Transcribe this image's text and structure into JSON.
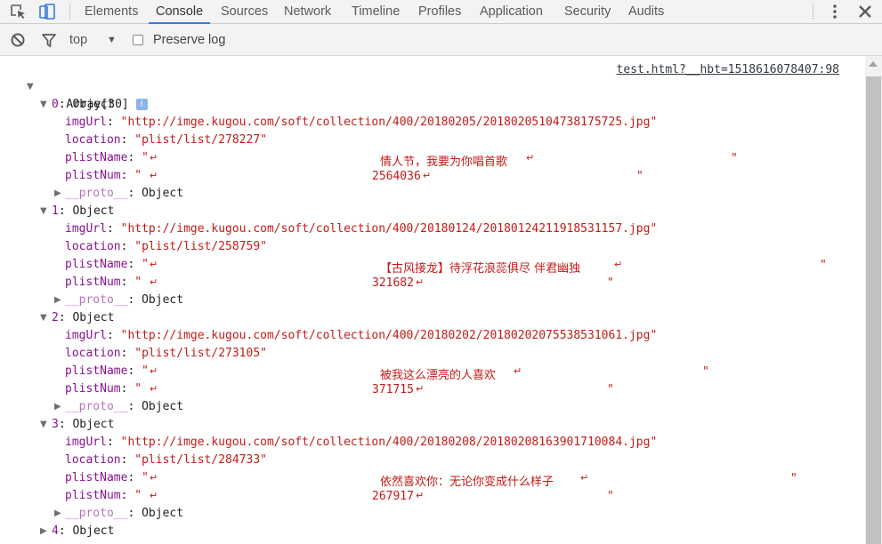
{
  "tabs": [
    "Elements",
    "Console",
    "Sources",
    "Network",
    "Timeline",
    "Profiles",
    "Application",
    "Security",
    "Audits"
  ],
  "active_tab": "Console",
  "toolbar": {
    "context": "top",
    "preserve_log": "Preserve log"
  },
  "source_link": "test.html?__hbt=1518616078407:98",
  "array_label": "Array[30]",
  "info_badge": "i",
  "labels": {
    "object": "Object",
    "proto": "__proto__",
    "imgUrl": "imgUrl",
    "location": "location",
    "plistName": "plistName",
    "plistNum": "plistNum",
    "return_mark": "↵",
    "quote": "\""
  },
  "items": [
    {
      "index": "0",
      "imgUrl": "\"http://imge.kugou.com/soft/collection/400/20180205/20180205104738175725.jpg\"",
      "location": "\"plist/list/278227\"",
      "plistName": "情人节，我要为你唱首歌",
      "plistNum": "2564036"
    },
    {
      "index": "1",
      "imgUrl": "\"http://imge.kugou.com/soft/collection/400/20180124/20180124211918531157.jpg\"",
      "location": "\"plist/list/258759\"",
      "plistName": "【古风接龙】待浮花浪蕊俱尽 伴君幽独",
      "plistNum": "321682"
    },
    {
      "index": "2",
      "imgUrl": "\"http://imge.kugou.com/soft/collection/400/20180202/20180202075538531061.jpg\"",
      "location": "\"plist/list/273105\"",
      "plistName": "被我这么漂亮的人喜欢",
      "plistNum": "371715"
    },
    {
      "index": "3",
      "imgUrl": "\"http://imge.kugou.com/soft/collection/400/20180208/20180208163901710084.jpg\"",
      "location": "\"plist/list/284733\"",
      "plistName": "依然喜欢你：无论你变成什么样子",
      "plistNum": "267917"
    },
    {
      "index": "4"
    }
  ]
}
